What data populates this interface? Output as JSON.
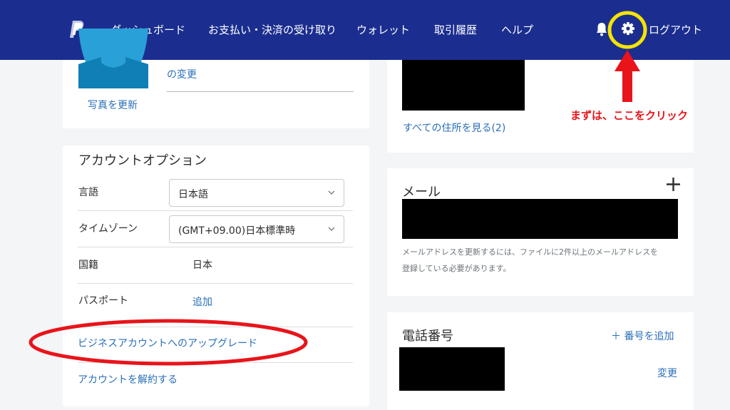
{
  "nav": {
    "items": [
      "ダッシュボード",
      "お支払い・決済の受け取り",
      "ウォレット",
      "取引履歴",
      "ヘルプ"
    ],
    "logout": "ログアウト",
    "icons": [
      "paypal-logo",
      "bell-icon",
      "gear-icon"
    ]
  },
  "profile": {
    "change_link": "の変更",
    "update_photo": "写真を更新"
  },
  "account_options": {
    "title": "アカウントオプション",
    "language_label": "言語",
    "language_value": "日本語",
    "timezone_label": "タイムゾーン",
    "timezone_value": "(GMT+09.00)日本標準時",
    "nationality_label": "国籍",
    "nationality_value": "日本",
    "passport_label": "パスポート",
    "passport_add": "追加",
    "upgrade_link": "ビジネスアカウントへのアップグレード",
    "close_account_link": "アカウントを解約する"
  },
  "address": {
    "view_all": "すべての住所を見る(2)"
  },
  "email": {
    "title": "メール",
    "note_line1": "メールアドレスを更新するには、ファイルに2件以上のメールアドレスを",
    "note_line2": "登録している必要があります。"
  },
  "phone": {
    "title": "電話番号",
    "add_number": "＋  番号を追加",
    "change": "変更"
  },
  "annotation": {
    "text": "まずは、ここをクリック",
    "color_red": "#e8141a",
    "color_yellow": "#f5e400"
  },
  "colors": {
    "nav_bg": "#1b2e8f",
    "link": "#2a6fb8"
  }
}
